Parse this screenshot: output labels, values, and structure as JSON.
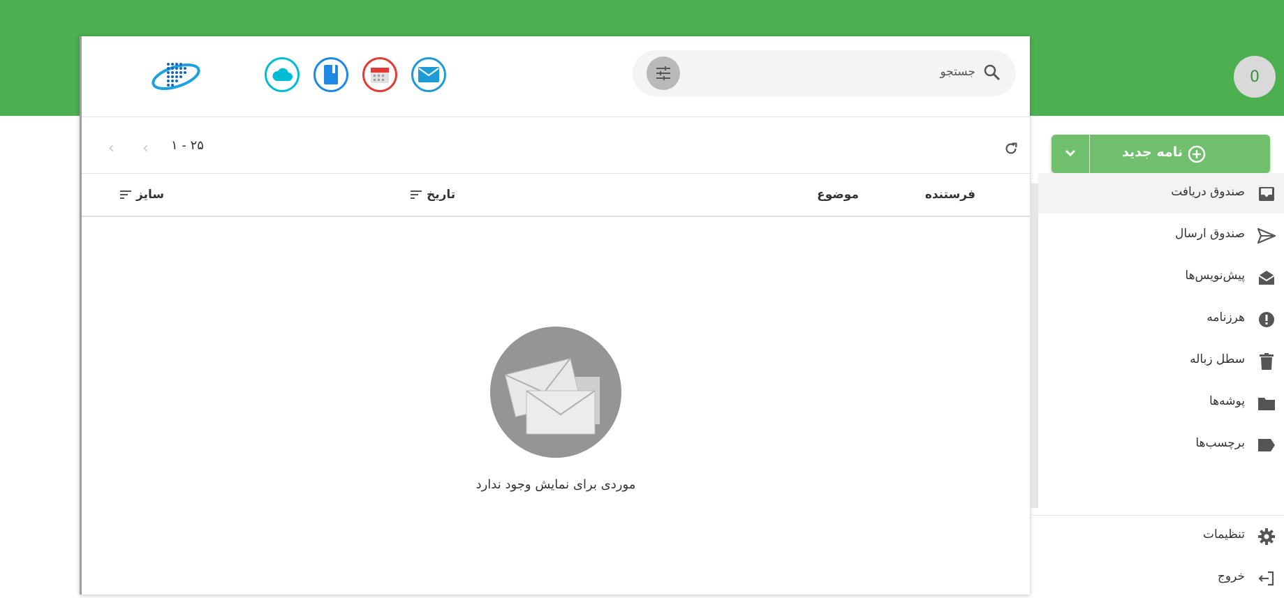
{
  "header": {
    "user_badge": "0",
    "search_placeholder": "جستجو",
    "apps": [
      {
        "icon": "cloud-icon",
        "color": "#00bcd4"
      },
      {
        "icon": "notebook-icon",
        "color": "#1e88e5"
      },
      {
        "icon": "calendar-icon",
        "color": "#e53935"
      },
      {
        "icon": "mail-icon",
        "color": "#1e9bd7"
      }
    ]
  },
  "toolbar": {
    "page_range": "۱ - ۲۵"
  },
  "columns": {
    "sender": "فرستنده",
    "subject": "موضوع",
    "date": "تاریخ",
    "size": "سایز"
  },
  "empty_state": {
    "message": "موردی برای نمایش وجود ندارد"
  },
  "sidebar": {
    "compose_label": "نامه جدید",
    "items": [
      {
        "label": "صندوق دریافت",
        "icon": "inbox-icon"
      },
      {
        "label": "صندوق ارسال",
        "icon": "send-icon"
      },
      {
        "label": "پیش‌نویس‌ها",
        "icon": "drafts-icon"
      },
      {
        "label": "هرزنامه",
        "icon": "spam-icon"
      },
      {
        "label": "سطل زباله",
        "icon": "trash-icon"
      },
      {
        "label": "پوشه‌ها",
        "icon": "folder-icon"
      },
      {
        "label": "برچسب‌ها",
        "icon": "label-icon"
      }
    ],
    "bottom": [
      {
        "label": "تنظیمات",
        "icon": "gear-icon"
      },
      {
        "label": "خروج",
        "icon": "logout-icon"
      }
    ]
  },
  "colors": {
    "brand_green": "#4caf50",
    "compose_green": "#6fbf6d"
  }
}
